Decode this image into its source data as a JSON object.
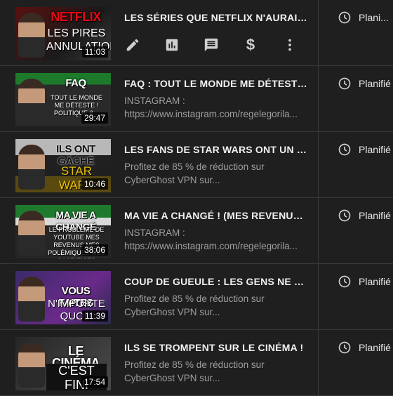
{
  "rows": [
    {
      "title": "LES SÉRIES QUE NETFLIX N'AURAIT J...",
      "duration": "11:03",
      "visibility": "Plani...",
      "thumb_banner": "NETFLIX",
      "thumb_sub": "LES PIRES ANNULATIONS",
      "desc_line1": "",
      "desc_line2": ""
    },
    {
      "title": "FAQ : TOUT LE MONDE ME DÉTESTE ...",
      "duration": "29:47",
      "visibility": "Planifié",
      "thumb_banner": "FAQ",
      "thumb_sub": "TOUT LE MONDE ME DÉTESTE ! POLITIQUE &...",
      "desc_line1": "INSTAGRAM :",
      "desc_line2": "https://www.instagram.com/regelegorila..."
    },
    {
      "title": "LES FANS DE STAR WARS ONT UN PR...",
      "duration": "10:46",
      "visibility": "Planifié",
      "thumb_banner": "ILS ONT GÂCHÉ",
      "thumb_sub": "STAR WARS",
      "desc_line1": "Profitez de 85 % de réduction sur",
      "desc_line2": "CyberGhost VPN sur..."
    },
    {
      "title": "MA VIE A CHANGÉ ! (MES REVENUS, ...",
      "duration": "38:06",
      "visibility": "Planifié",
      "thumb_banner": "MA VIE A CHANGÉ",
      "thumb_sub": "LE PROBLÈME DE YOUTUBE MES REVENUS MES POLÉMIQUES MES SACRIFICES",
      "desc_line1": "INSTAGRAM :",
      "desc_line2": "https://www.instagram.com/regelegorila..."
    },
    {
      "title": "COUP DE GUEULE : LES GENS NE SAV...",
      "duration": "11:39",
      "visibility": "Planifié",
      "thumb_banner": "VOUS FAITES",
      "thumb_sub": "N'IMPORTE QUOI !",
      "desc_line1": "Profitez de 85 % de réduction sur",
      "desc_line2": "CyberGhost VPN sur..."
    },
    {
      "title": "ILS SE TROMPENT SUR LE CINÉMA !",
      "duration": "17:54",
      "visibility": "Planifié",
      "thumb_banner": "LE CINÉMA",
      "thumb_sub": "C'EST FINI",
      "desc_line1": "Profitez de 85 % de réduction sur",
      "desc_line2": "CyberGhost VPN sur..."
    }
  ],
  "actions": [
    {
      "name": "edit-icon"
    },
    {
      "name": "analytics-icon"
    },
    {
      "name": "comments-icon"
    },
    {
      "name": "monetization-icon"
    },
    {
      "name": "more-options-icon"
    }
  ],
  "colors": {
    "background": "#1f1f1f",
    "title": "#f1f1f1",
    "description": "#9e9e9e",
    "divider": "#3a3a3a"
  }
}
